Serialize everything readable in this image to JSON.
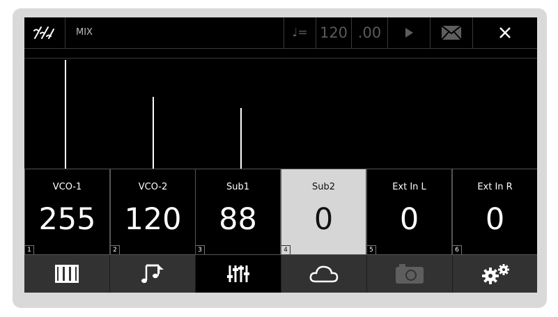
{
  "header": {
    "logo_icon": "wavy-sliders-logo-icon",
    "mode": "MIX",
    "tempo_icon": "♩=",
    "tempo_integer": "120",
    "tempo_decimal": ".00",
    "play_icon": "play-icon",
    "mail_icon": "envelope-icon",
    "close_icon": "close-icon"
  },
  "levels": [
    {
      "channel": "VCO-1",
      "level": 255
    },
    {
      "channel": "VCO-2",
      "level": 120
    },
    {
      "channel": "Sub1",
      "level": 88
    },
    {
      "channel": "Sub2",
      "level": 0
    },
    {
      "channel": "Ext In L",
      "level": 0
    },
    {
      "channel": "Ext In R",
      "level": 0
    }
  ],
  "channels": [
    {
      "name": "VCO-1",
      "value": "255",
      "index": "1",
      "selected": false
    },
    {
      "name": "VCO-2",
      "value": "120",
      "index": "2",
      "selected": false
    },
    {
      "name": "Sub1",
      "value": "88",
      "index": "3",
      "selected": false
    },
    {
      "name": "Sub2",
      "value": "0",
      "index": "4",
      "selected": true
    },
    {
      "name": "Ext In L",
      "value": "0",
      "index": "5",
      "selected": false
    },
    {
      "name": "Ext In R",
      "value": "0",
      "index": "6",
      "selected": false
    }
  ],
  "tabs": [
    {
      "icon": "piano-keys-icon",
      "active": false
    },
    {
      "icon": "music-notes-icon",
      "active": false
    },
    {
      "icon": "mixer-sliders-icon",
      "active": true
    },
    {
      "icon": "cloud-icon",
      "active": false
    },
    {
      "icon": "camera-icon",
      "active": false,
      "disabled": true
    },
    {
      "icon": "gears-icon",
      "active": false
    }
  ],
  "colors": {
    "selected_bg": "#d6d6d6",
    "tab_bg": "#323232",
    "accent": "#ffffff"
  }
}
